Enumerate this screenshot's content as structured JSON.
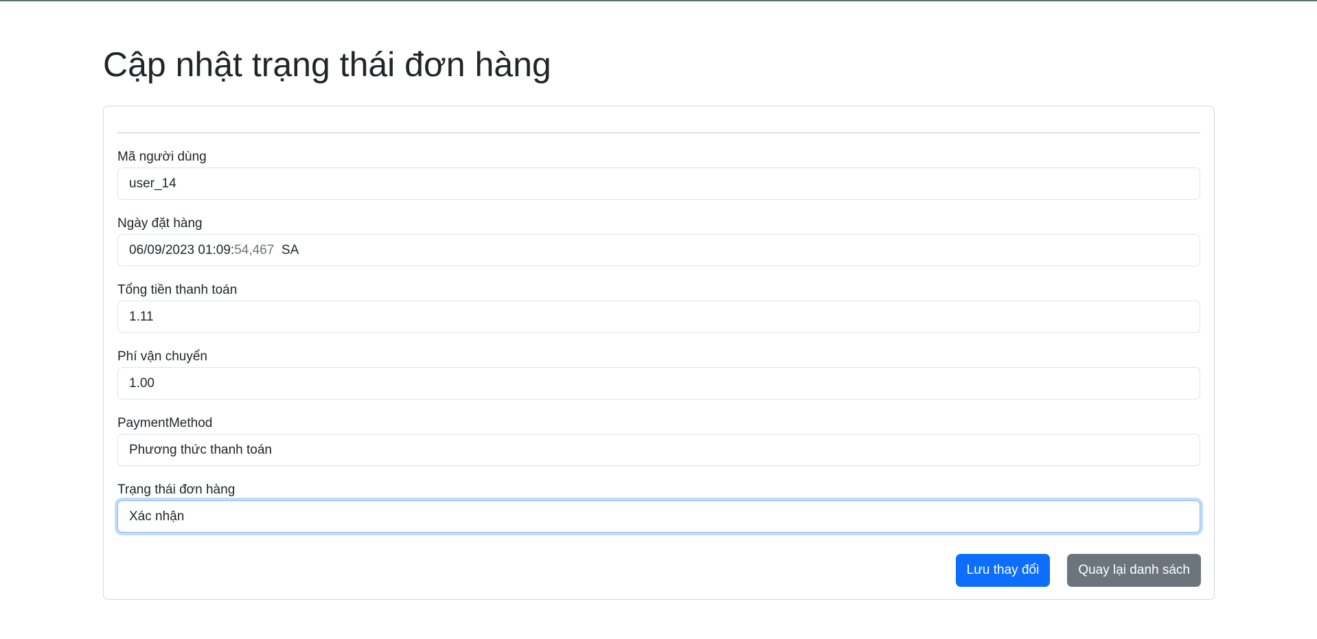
{
  "page": {
    "title": "Cập nhật trạng thái đơn hàng"
  },
  "form": {
    "fields": [
      {
        "label": "Mã người dùng",
        "value": "user_14"
      },
      {
        "label": "Ngày đặt hàng",
        "value_main": "06/09/2023 01:09:",
        "value_dim": "54,467",
        "value_suffix": "SA"
      },
      {
        "label": "Tổng tiền thanh toán",
        "value": "1.11"
      },
      {
        "label": "Phí vận chuyển",
        "value": "1.00"
      },
      {
        "label": "PaymentMethod",
        "value": "Phương thức thanh toán"
      },
      {
        "label": "Trạng thái đơn hàng",
        "value": "Xác nhận"
      }
    ],
    "save_label": "Lưu thay đổi",
    "back_label": "Quay lại danh sách"
  },
  "colors": {
    "primary": "#0d6efd",
    "secondary": "#6c757d",
    "focus_border": "#86b7fe"
  }
}
